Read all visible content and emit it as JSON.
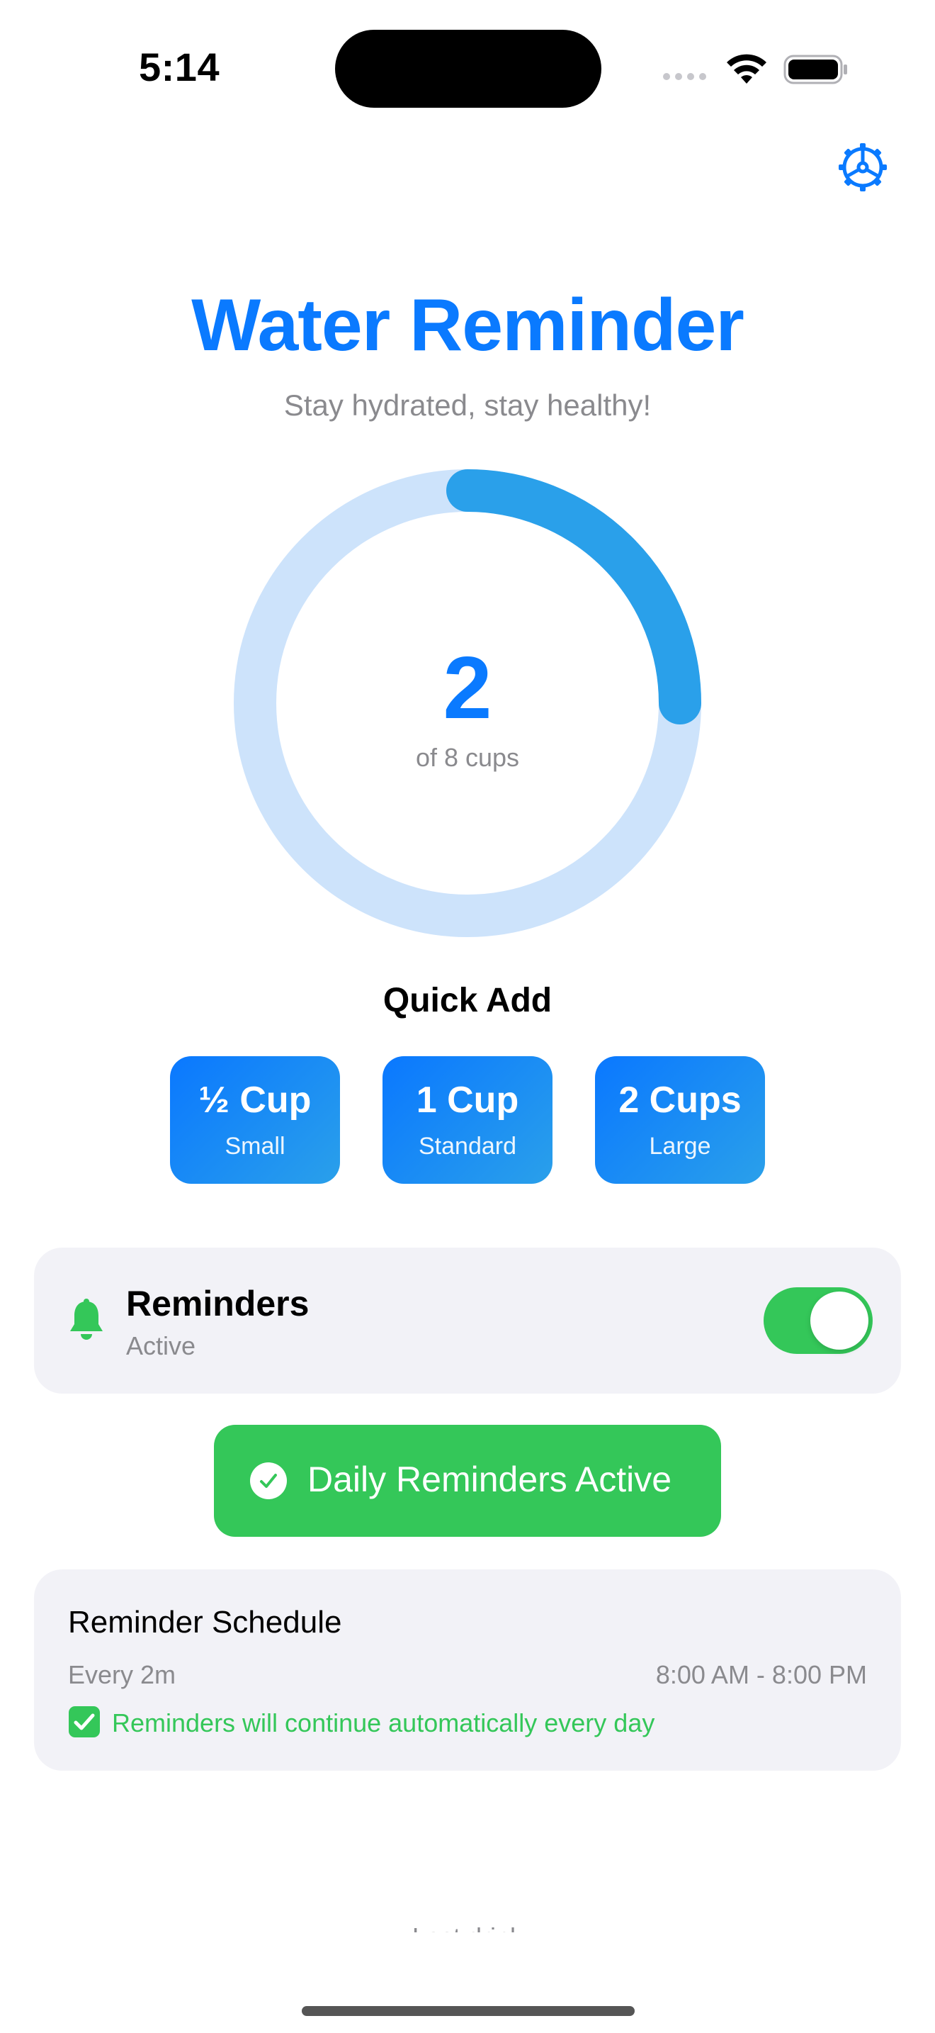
{
  "status_bar": {
    "time": "5:14"
  },
  "header": {
    "title": "Water Reminder",
    "subtitle": "Stay hydrated, stay healthy!"
  },
  "progress": {
    "current": "2",
    "goal_text": "of 8 cups",
    "fraction": 0.25
  },
  "quick_add": {
    "title": "Quick Add",
    "buttons": [
      {
        "label": "½ Cup",
        "sub": "Small"
      },
      {
        "label": "1 Cup",
        "sub": "Standard"
      },
      {
        "label": "2 Cups",
        "sub": "Large"
      }
    ]
  },
  "reminders": {
    "title": "Reminders",
    "status": "Active",
    "enabled": true
  },
  "daily_button": {
    "label": "Daily Reminders Active"
  },
  "schedule": {
    "title": "Reminder Schedule",
    "interval": "Every 2m",
    "hours": "8:00 AM - 8:00 PM",
    "note": "Reminders will continue automatically every day"
  },
  "footer": {
    "last_drink": "Last drink"
  },
  "colors": {
    "accent": "#0a7aff",
    "ring_track": "#cde3fb",
    "ring_progress": "#2aa0ea",
    "green": "#34c759"
  },
  "icons": {
    "settings": "gear-icon",
    "bell": "bell-icon",
    "check": "checkmark-circle-icon",
    "note_check": "check-box-icon"
  }
}
